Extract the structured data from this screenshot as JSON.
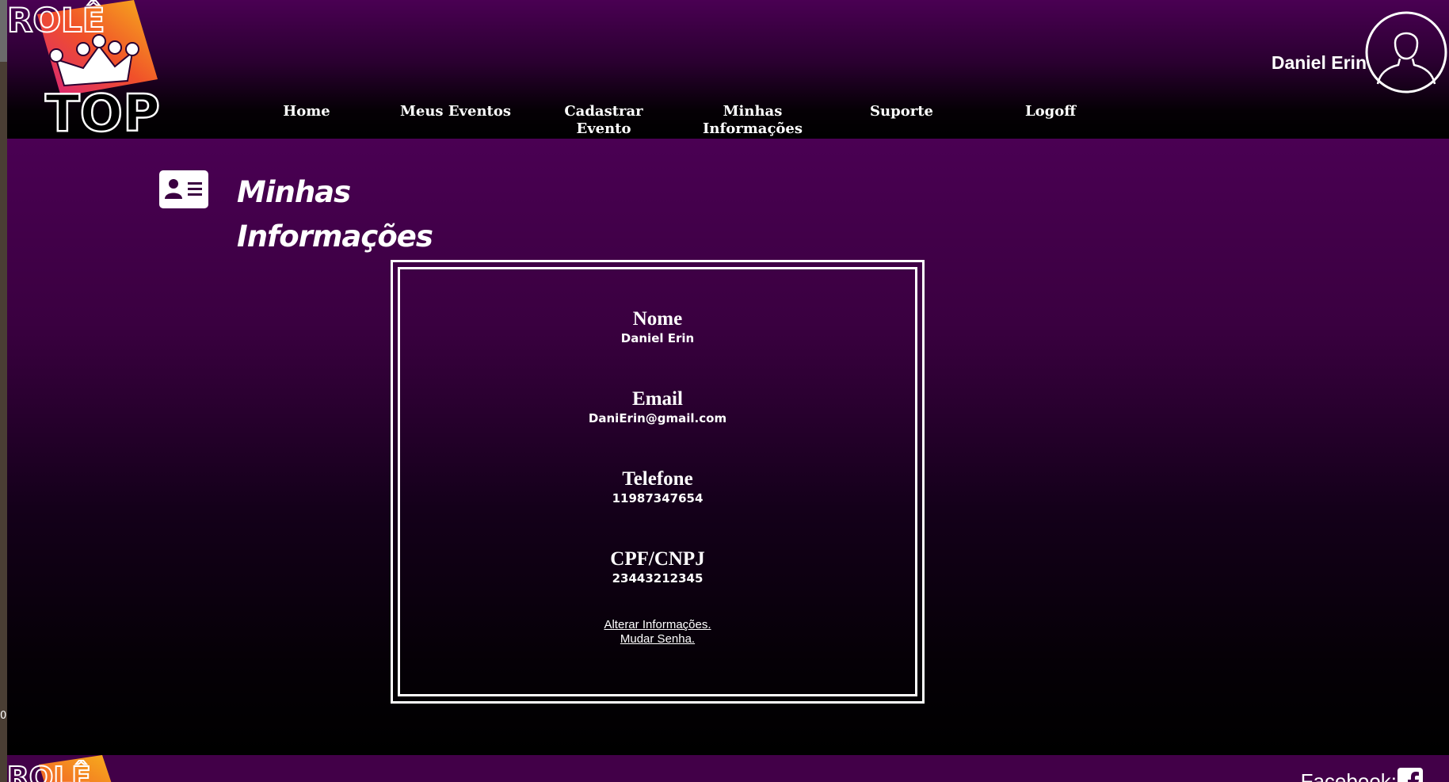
{
  "header": {
    "logo_top_text": "ROLÊ",
    "logo_bottom_text": "TOP",
    "user_name": "Daniel Erin"
  },
  "nav": {
    "items": [
      {
        "label": "Home"
      },
      {
        "label": "Meus Eventos"
      },
      {
        "label": "Cadastrar Evento"
      },
      {
        "label": "Minhas Informações"
      },
      {
        "label": "Suporte"
      },
      {
        "label": "Logoff"
      }
    ]
  },
  "main": {
    "title": "Minhas Informações",
    "fields": [
      {
        "label": "Nome",
        "value": "Daniel Erin"
      },
      {
        "label": "Email",
        "value": "DaniErin@gmail.com"
      },
      {
        "label": "Telefone",
        "value": "11987347654"
      },
      {
        "label": "CPF/CNPJ",
        "value": "23443212345"
      }
    ],
    "links": {
      "edit": "Alterar Informações.",
      "password": "Mudar Senha."
    }
  },
  "side_label": "0",
  "footer": {
    "logo_text": "ROLÊ",
    "facebook_label": "Facebook:"
  },
  "colors": {
    "brand_purple": "#4a0053",
    "logo_orange": "#f5a21b",
    "logo_pink": "#e2307f"
  }
}
